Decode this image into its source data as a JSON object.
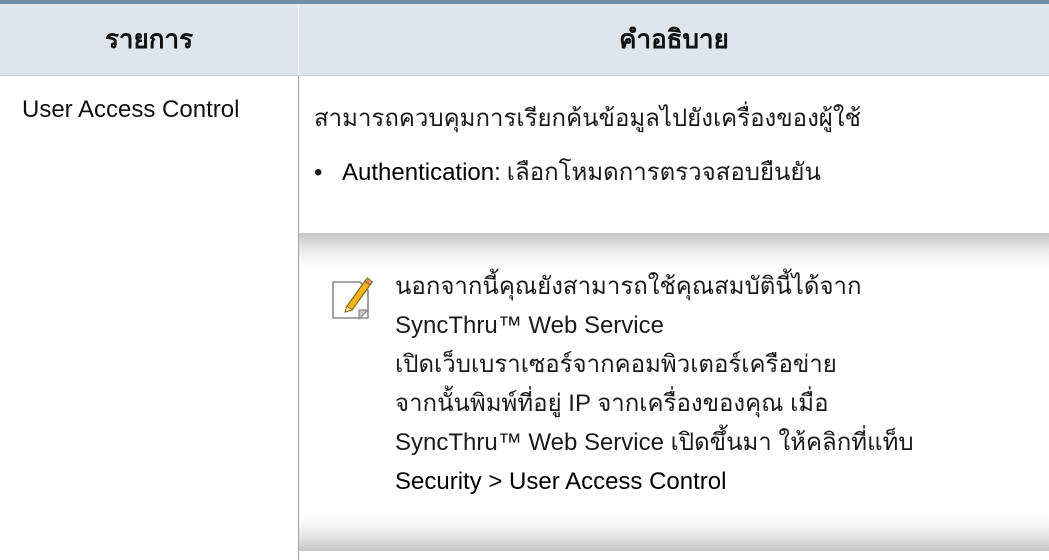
{
  "table": {
    "header": {
      "col_item": "รายการ",
      "col_description": "คำอธิบาย"
    },
    "row": {
      "item_name": "User Access Control",
      "description": "สามารถควบคุมการเรียกค้นข้อมูลไปยังเครื่องของผู้ใช้",
      "bullet": {
        "label": "Authentication:",
        "text": "เลือกโหมดการตรวจสอบยืนยัน"
      },
      "note": {
        "icon": "note-pencil-icon",
        "lines": [
          "นอกจากนี้คุณยังสามารถใช้คุณสมบัตินี้ได้จาก",
          "SyncThru™ Web Service",
          "เปิดเว็บเบราเซอร์จากคอมพิวเตอร์เครือข่าย",
          "จากนั้นพิมพ์ที่อยู่ IP จากเครื่องของคุณ เมื่อ",
          "SyncThru™ Web Service เปิดขึ้นมา ให้คลิกที่แท็บ"
        ],
        "menu_path": "Security > User Access Control"
      }
    }
  },
  "colors": {
    "top_rule": "#6f8fa9",
    "header_bg": "#dfe5ea",
    "note_shadow": "#c6c6c6"
  }
}
